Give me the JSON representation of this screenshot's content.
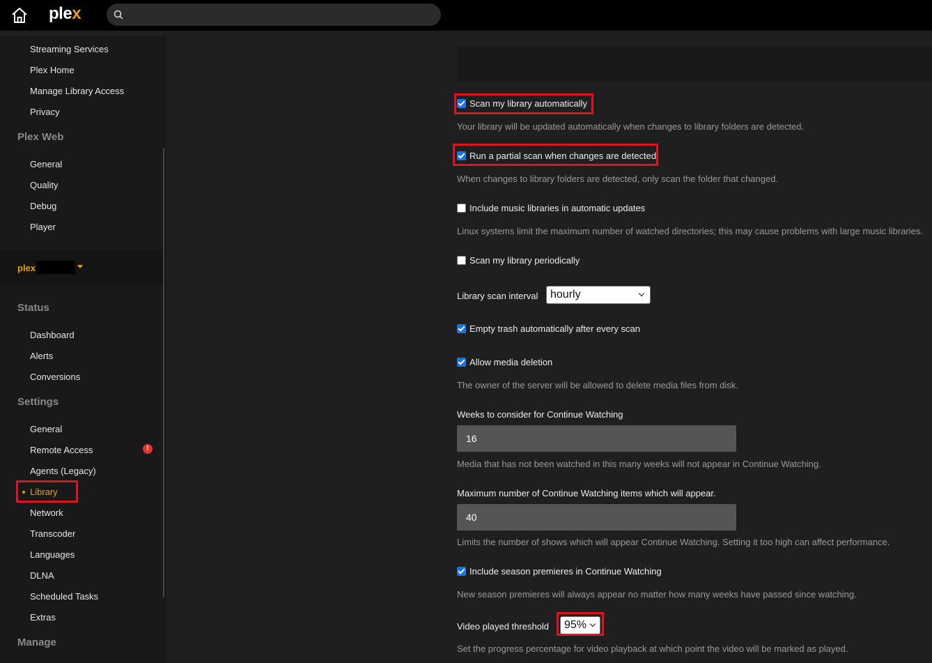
{
  "app": {
    "logo_main": "ple",
    "logo_accent": "x"
  },
  "search": {
    "placeholder": ""
  },
  "sidebar": {
    "account_items": [
      "Streaming Services",
      "Plex Home",
      "Manage Library Access",
      "Privacy"
    ],
    "plex_web_heading": "Plex Web",
    "plex_web_items": [
      "General",
      "Quality",
      "Debug",
      "Player"
    ],
    "server_name": "plex",
    "status_heading": "Status",
    "status_items": [
      "Dashboard",
      "Alerts",
      "Conversions"
    ],
    "settings_heading": "Settings",
    "settings_items": [
      "General",
      "Remote Access",
      "Agents (Legacy)",
      "Library",
      "Network",
      "Transcoder",
      "Languages",
      "DLNA",
      "Scheduled Tasks",
      "Extras"
    ],
    "remote_access_badge": "!",
    "manage_heading": "Manage",
    "active_item": "Library"
  },
  "settings": {
    "scan_auto": {
      "label": "Scan my library automatically",
      "checked": true,
      "help": "Your library will be updated automatically when changes to library folders are detected."
    },
    "partial_scan": {
      "label": "Run a partial scan when changes are detected",
      "checked": true,
      "help": "When changes to library folders are detected, only scan the folder that changed."
    },
    "music_updates": {
      "label": "Include music libraries in automatic updates",
      "checked": false,
      "help": "Linux systems limit the maximum number of watched directories; this may cause problems with large music libraries."
    },
    "scan_periodic": {
      "label": "Scan my library periodically",
      "checked": false
    },
    "scan_interval": {
      "label": "Library scan interval",
      "value": "hourly"
    },
    "empty_trash": {
      "label": "Empty trash automatically after every scan",
      "checked": true
    },
    "allow_deletion": {
      "label": "Allow media deletion",
      "checked": true,
      "help": "The owner of the server will be allowed to delete media files from disk."
    },
    "weeks_continue": {
      "label": "Weeks to consider for Continue Watching",
      "value": "16",
      "help": "Media that has not been watched in this many weeks will not appear in Continue Watching."
    },
    "max_continue": {
      "label": "Maximum number of Continue Watching items which will appear.",
      "value": "40",
      "help": "Limits the number of shows which will appear Continue Watching. Setting it too high can affect performance."
    },
    "season_premieres": {
      "label": "Include season premieres in Continue Watching",
      "checked": true,
      "help": "New season premieres will always appear no matter how many weeks have passed since watching."
    },
    "played_threshold": {
      "label": "Video played threshold",
      "value": "95%",
      "help": "Set the progress percentage for video playback at which point the video will be marked as played."
    }
  },
  "colors": {
    "accent": "#e5a00d",
    "highlight": "#e0141e",
    "checkbox": "#1a73e8"
  }
}
